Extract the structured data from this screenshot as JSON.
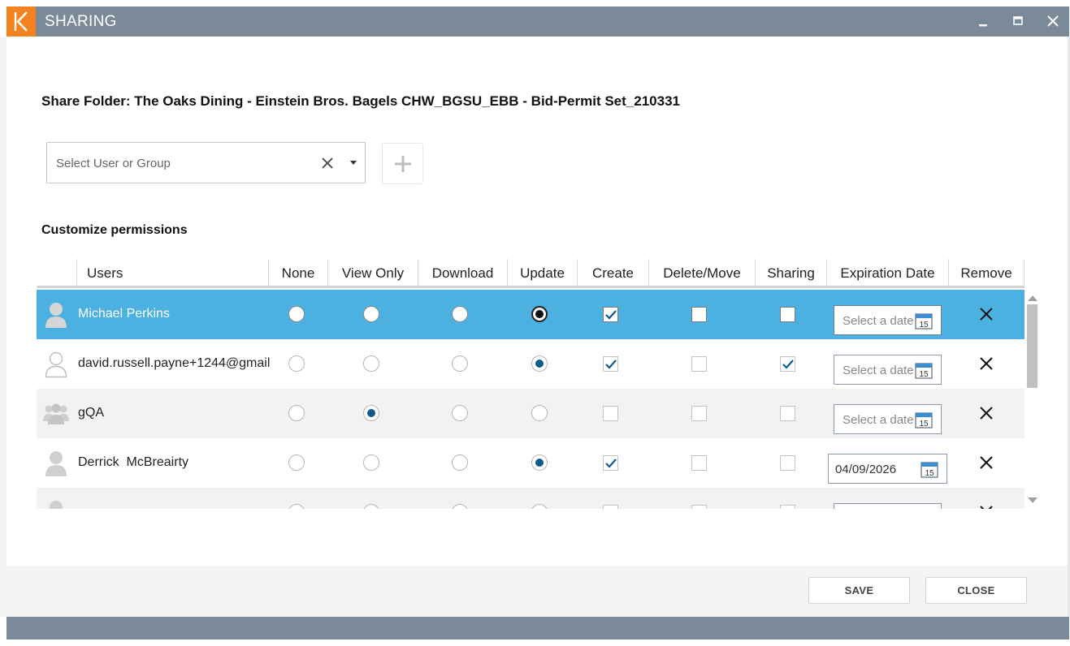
{
  "window": {
    "title": "SHARING",
    "accent": "#f58220",
    "titlebar_color": "#7b8a99",
    "selected_row_color": "#4cb1e0"
  },
  "heading": "Share Folder: The Oaks Dining - Einstein Bros. Bagels CHW_BGSU_EBB - Bid-Permit Set_210331",
  "user_select": {
    "placeholder": "Select User or Group"
  },
  "permissions_heading": "Customize permissions",
  "columns": [
    "Users",
    "None",
    "View Only",
    "Download",
    "Update",
    "Create",
    "Delete/Move",
    "Sharing",
    "Expiration Date",
    "Remove"
  ],
  "rows": [
    {
      "name": "Michael Perkins",
      "avatar": "person-icon",
      "access": "Update",
      "create": true,
      "delete_move": false,
      "sharing": false,
      "expiration": "",
      "date_placeholder": "Select a date",
      "selected": true
    },
    {
      "name": "david.russell.payne+1244@gmail",
      "avatar": "person-outline-icon",
      "access": "Update",
      "create": true,
      "delete_move": false,
      "sharing": true,
      "expiration": "",
      "date_placeholder": "Select a date",
      "selected": false
    },
    {
      "name": "gQA",
      "avatar": "group-icon",
      "access": "View Only",
      "create": false,
      "delete_move": false,
      "sharing": false,
      "expiration": "",
      "date_placeholder": "Select a date",
      "selected": false
    },
    {
      "name": "Derrick  McBreairty",
      "avatar": "person-icon",
      "access": "Update",
      "create": true,
      "delete_move": false,
      "sharing": false,
      "expiration": "04/09/2026",
      "date_placeholder": "",
      "selected": false
    }
  ],
  "calendar_day": "15",
  "footer": {
    "save_label": "SAVE",
    "close_label": "CLOSE"
  }
}
